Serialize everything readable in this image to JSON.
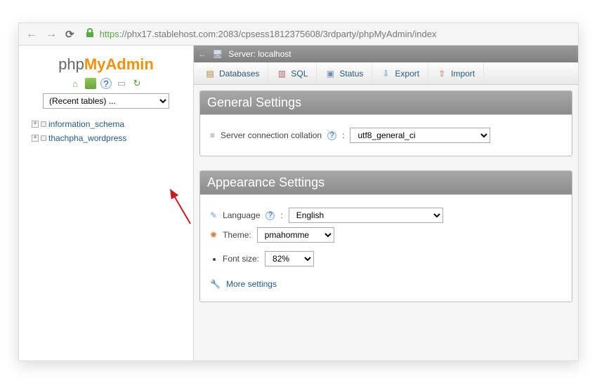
{
  "browser": {
    "url_protocol": "https",
    "url_rest": "://phx17.stablehost.com:2083/cpsess1812375608/3rdparty/phpMyAdmin/index"
  },
  "logo": {
    "part1": "php",
    "part2": "MyAdmin"
  },
  "sidebar": {
    "recent_placeholder": "(Recent tables) ...",
    "databases": [
      {
        "name": "information_schema"
      },
      {
        "name": "thachpha_wordpress"
      }
    ]
  },
  "breadcrumb": {
    "server_label": "Server: localhost"
  },
  "tabs": [
    {
      "label": "Databases",
      "icon": "db"
    },
    {
      "label": "SQL",
      "icon": "sql"
    },
    {
      "label": "Status",
      "icon": "stat"
    },
    {
      "label": "Export",
      "icon": "exp"
    },
    {
      "label": "Import",
      "icon": "imp"
    }
  ],
  "general": {
    "title": "General Settings",
    "collation_label": "Server connection collation",
    "collation_value": "utf8_general_ci"
  },
  "appearance": {
    "title": "Appearance Settings",
    "language_label": "Language",
    "language_value": "English",
    "theme_label": "Theme:",
    "theme_value": "pmahomme",
    "fontsize_label": "Font size:",
    "fontsize_value": "82%",
    "more_settings": "More settings"
  }
}
